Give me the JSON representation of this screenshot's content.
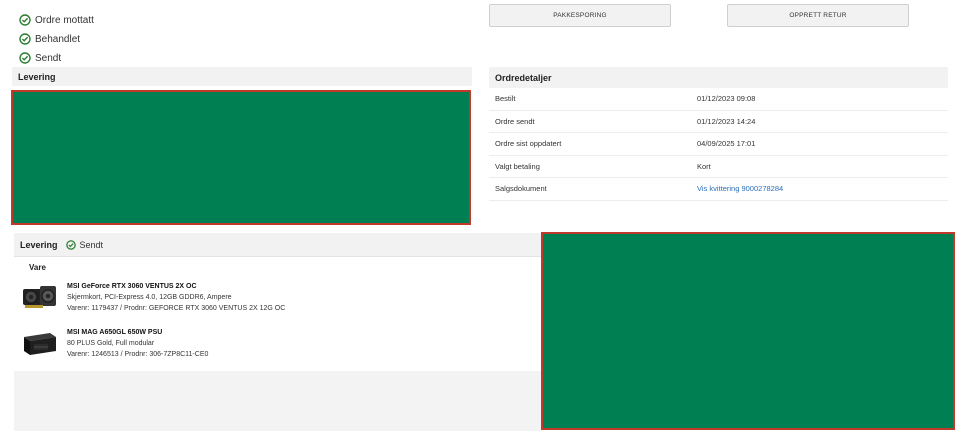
{
  "status": {
    "items": [
      {
        "label": "Ordre mottatt"
      },
      {
        "label": "Behandlet"
      },
      {
        "label": "Sendt"
      }
    ],
    "color": "#2e7d32"
  },
  "buttons": {
    "tracking": "PAKKESPORING",
    "return": "OPPRETT RETUR"
  },
  "levering_header": "Levering",
  "order_details": {
    "title": "Ordredetaljer",
    "rows": [
      {
        "key": "Bestilt",
        "value": "01/12/2023 09:08"
      },
      {
        "key": "Ordre sendt",
        "value": "01/12/2023 14:24"
      },
      {
        "key": "Ordre sist oppdatert",
        "value": "04/09/2025 17:01"
      },
      {
        "key": "Valgt betaling",
        "value": "Kort"
      },
      {
        "key": "Salgsdokument",
        "value": "Vis kvittering 9000278284"
      }
    ]
  },
  "delivery": {
    "title": "Levering",
    "status": "Sendt",
    "column_label": "Vare",
    "items": [
      {
        "name": "MSI GeForce RTX 3060 VENTUS 2X OC",
        "description": "Skjermkort, PCI-Express 4.0, 12GB GDDR6, Ampere",
        "ids": "Varenr: 1179437 / Prodnr: GEFORCE RTX 3060 VENTUS 2X 12G OC",
        "icon": "graphics-card-icon"
      },
      {
        "name": "MSI MAG A650GL 650W PSU",
        "description": "80 PLUS Gold, Full modular",
        "ids": "Varenr: 1246513 / Prodnr: 306-7ZP8C11-CE0",
        "icon": "power-supply-icon"
      }
    ]
  },
  "colors": {
    "redaction": "#008052",
    "redaction_border": "#c0392b",
    "link": "#2a6ebb"
  }
}
